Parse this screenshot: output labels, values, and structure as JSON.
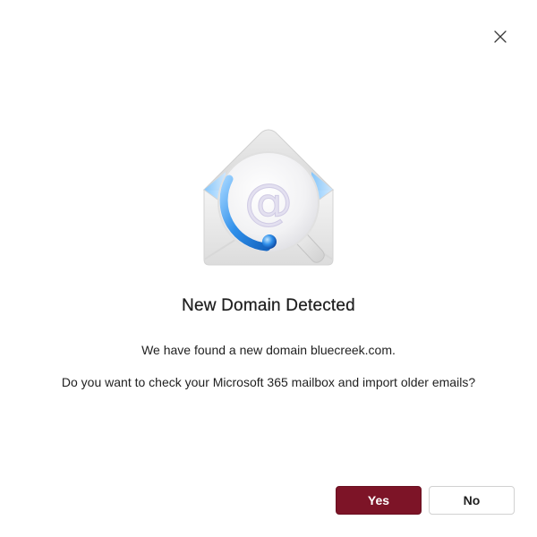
{
  "dialog": {
    "title": "New Domain Detected",
    "message_line1": "We have found a new domain bluecreek.com.",
    "message_line2": "Do you want to check your Microsoft 365 mailbox and import older emails?",
    "close_icon": "close-icon",
    "hero_icon": "envelope-search-icon"
  },
  "buttons": {
    "yes_label": "Yes",
    "no_label": "No"
  },
  "colors": {
    "primary": "#7d1427",
    "text": "#1f1f1f",
    "accent_blue": "#1e88e5"
  }
}
